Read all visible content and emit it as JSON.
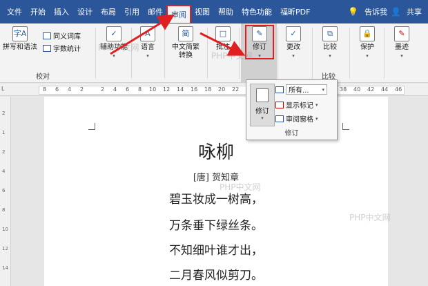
{
  "tabs": [
    "文件",
    "开始",
    "插入",
    "设计",
    "布局",
    "引用",
    "邮件",
    "审阅",
    "视图",
    "帮助",
    "特色功能",
    "福昕PDF"
  ],
  "tab_right": {
    "tell_me": "告诉我",
    "share": "共享"
  },
  "ribbon": {
    "spelling": "拼写和语法",
    "thesaurus": "同义词库",
    "word_count": "字数统计",
    "proofing_group": "校对",
    "accessibility": "辅助功能",
    "language": "语言",
    "chinese_convert": "中文简繁\n转换",
    "comment": "批注",
    "track": "修订",
    "changes": "更改",
    "compare": "比较",
    "compare_group": "比较",
    "protect": "保护",
    "ink": "墨迹"
  },
  "ruler": {
    "corner": "L",
    "numbers": [
      "8",
      "6",
      "4",
      "2",
      "2",
      "4",
      "6",
      "8",
      "10",
      "12",
      "14",
      "16",
      "18",
      "20",
      "22",
      "24",
      "26",
      "28",
      "38",
      "40",
      "42",
      "44",
      "46"
    ]
  },
  "vruler_numbers": [
    "2",
    "1",
    "2",
    "4",
    "6",
    "8",
    "10",
    "12",
    "14"
  ],
  "document": {
    "title": "咏柳",
    "author": "[唐] 贺知章",
    "lines": [
      "碧玉妆成一树高，",
      "万条垂下绿丝条。",
      "不知细叶谁才出，",
      "二月春风似剪刀。"
    ]
  },
  "popup": {
    "track_button": "修订",
    "markup_select": "所有...",
    "show_markup": "显示标记",
    "review_pane": "审阅窗格",
    "group_label": "修订"
  },
  "watermarks": [
    "PHP中文网",
    "PHP中文网",
    "PHP中文网",
    "PHP中文网"
  ],
  "colors": {
    "ribbon_blue": "#2b579a",
    "highlight_red": "#e02020"
  }
}
